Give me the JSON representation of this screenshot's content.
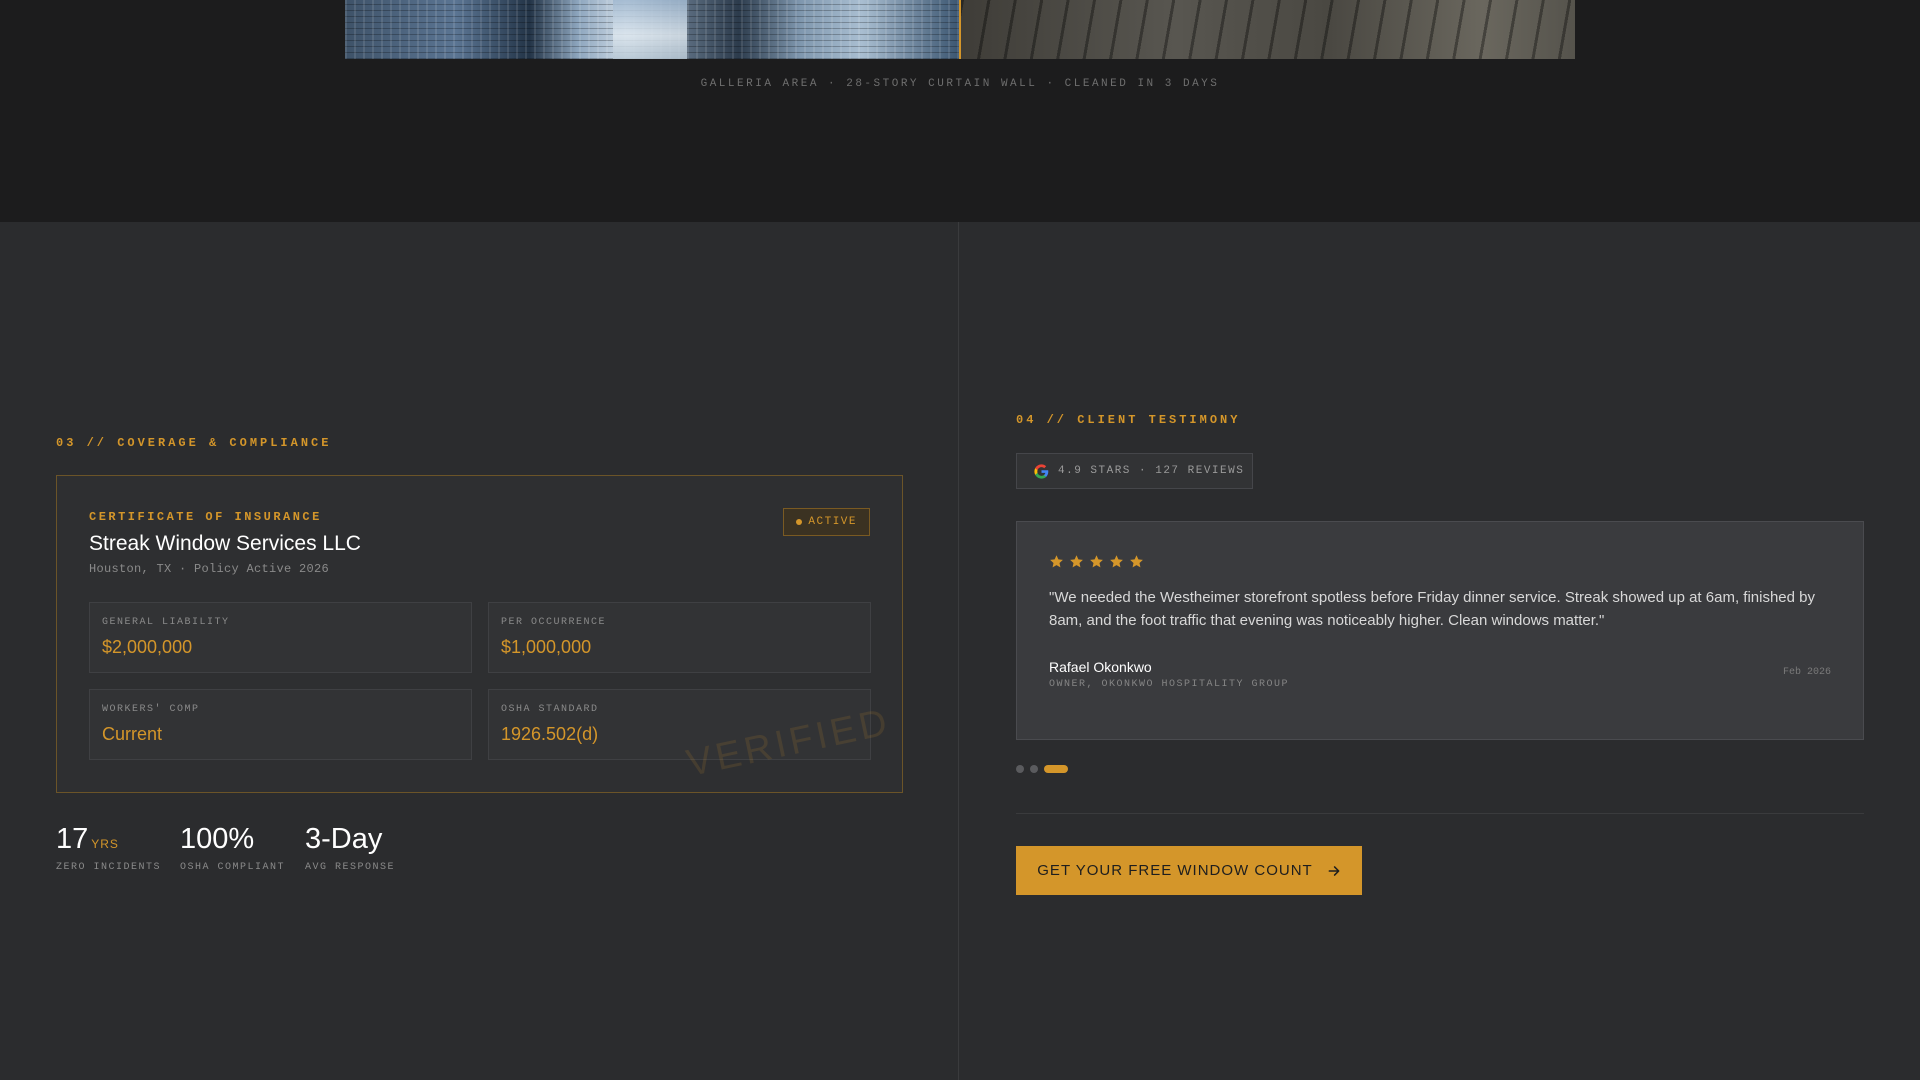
{
  "top": {
    "caption": "GALLERIA AREA · 28-STORY CURTAIN WALL · CLEANED IN 3 DAYS"
  },
  "coverage": {
    "eyebrow": "03 // COVERAGE & COMPLIANCE",
    "card": {
      "eyebrow": "CERTIFICATE OF INSURANCE",
      "title": "Streak Window Services LLC",
      "subtitle": "Houston, TX · Policy Active 2026",
      "badge": "ACTIVE",
      "watermark": "VERIFIED",
      "items": [
        {
          "label": "GENERAL LIABILITY",
          "value": "$2,000,000"
        },
        {
          "label": "PER OCCURRENCE",
          "value": "$1,000,000"
        },
        {
          "label": "WORKERS' COMP",
          "value": "Current"
        },
        {
          "label": "OSHA STANDARD",
          "value": "1926.502(d)"
        }
      ]
    },
    "metrics": [
      {
        "value": "17",
        "unit": "YRS",
        "caption": "ZERO INCIDENTS"
      },
      {
        "value": "100%",
        "unit": "",
        "caption": "OSHA COMPLIANT"
      },
      {
        "value": "3-Day",
        "unit": "",
        "caption": "AVG RESPONSE"
      }
    ]
  },
  "testimony": {
    "eyebrow": "04 // CLIENT TESTIMONY",
    "rating": "4.9 STARS · 127 REVIEWS",
    "stars": 5,
    "quote": "\"We needed the Westheimer storefront spotless before Friday dinner service. Streak showed up at 6am, finished by 8am, and the foot traffic that evening was noticeably higher. Clean windows matter.\"",
    "author": "Rafael Okonkwo",
    "role": "OWNER, OKONKWO HOSPITALITY GROUP",
    "date": "Feb 2026",
    "carousel": {
      "count": 3,
      "active": 3
    }
  },
  "cta": {
    "label": "GET YOUR FREE WINDOW COUNT"
  },
  "colors": {
    "accent": "#d4962a",
    "background": "#2b2c2e",
    "band": "#1c1c1d"
  }
}
